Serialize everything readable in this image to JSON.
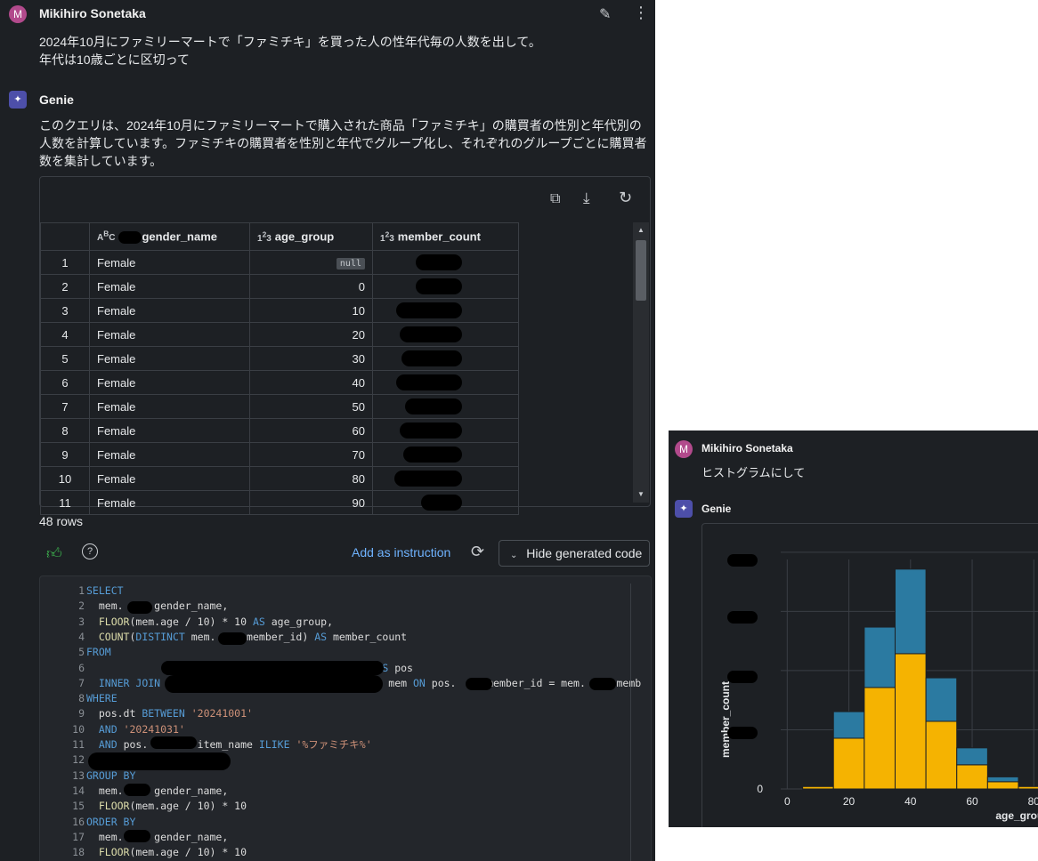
{
  "conversation": {
    "user_name": "Mikihiro Sonetaka",
    "user_initial": "M",
    "user_message_1": "2024年10月にファミリーマートで「ファミチキ」を買った人の性年代毎の人数を出して。",
    "user_message_2": "年代は10歳ごとに区切って",
    "genie_name": "Genie",
    "genie_reply_1": "このクエリは、2024年10月にファミリーマートで購入された商品「ファミチキ」の購買者の性別と年代別の",
    "genie_reply_2": "人数を計算しています。ファミチキの購買者を性別と年代でグループ化し、それぞれのグループごとに購買者",
    "genie_reply_3": "数を集計しています。"
  },
  "result_table": {
    "columns": [
      "gender_name",
      "age_group",
      "member_count"
    ],
    "rows": [
      {
        "idx": "1",
        "gender": "Female",
        "age": "null"
      },
      {
        "idx": "2",
        "gender": "Female",
        "age": "0"
      },
      {
        "idx": "3",
        "gender": "Female",
        "age": "10"
      },
      {
        "idx": "4",
        "gender": "Female",
        "age": "20"
      },
      {
        "idx": "5",
        "gender": "Female",
        "age": "30"
      },
      {
        "idx": "6",
        "gender": "Female",
        "age": "40"
      },
      {
        "idx": "7",
        "gender": "Female",
        "age": "50"
      },
      {
        "idx": "8",
        "gender": "Female",
        "age": "60"
      },
      {
        "idx": "9",
        "gender": "Female",
        "age": "70"
      },
      {
        "idx": "10",
        "gender": "Female",
        "age": "80"
      },
      {
        "idx": "11",
        "gender": "Female",
        "age": "90"
      }
    ],
    "rows_count": "48 rows"
  },
  "toolbar": {
    "add_instruction": "Add as instruction",
    "hide_code": "Hide generated code"
  },
  "code": [
    {
      "n": "1",
      "t": "SELECT"
    },
    {
      "n": "2",
      "t": "  mem.     gender_name,"
    },
    {
      "n": "3",
      "t": "  FLOOR(mem.age / 10) * 10 AS age_group,"
    },
    {
      "n": "4",
      "t": "  COUNT(DISTINCT mem.     member_id) AS member_count"
    },
    {
      "n": "5",
      "t": "FROM"
    },
    {
      "n": "6",
      "t": "                                               AS pos"
    },
    {
      "n": "7",
      "t": "  INNER JOIN                                  AS mem ON pos.     member_id = mem.     memb"
    },
    {
      "n": "8",
      "t": "WHERE"
    },
    {
      "n": "9",
      "t": "  pos.dt BETWEEN '20241001'"
    },
    {
      "n": "10",
      "t": "  AND '20241031'"
    },
    {
      "n": "11",
      "t": "  AND pos.        item_name ILIKE '%ファミチキ%'"
    },
    {
      "n": "12",
      "t": ""
    },
    {
      "n": "13",
      "t": "GROUP BY"
    },
    {
      "n": "14",
      "t": "  mem.     gender_name,"
    },
    {
      "n": "15",
      "t": "  FLOOR(mem.age / 10) * 10"
    },
    {
      "n": "16",
      "t": "ORDER BY"
    },
    {
      "n": "17",
      "t": "  mem.     gender_name,"
    },
    {
      "n": "18",
      "t": "  FLOOR(mem.age / 10) * 10"
    }
  ],
  "second_conversation": {
    "user_name": "Mikihiro Sonetaka",
    "user_initial": "M",
    "user_message": "ヒストグラムにして",
    "genie_name": "Genie"
  },
  "chart_data": {
    "type": "bar",
    "stacked": true,
    "xlabel": "age_group",
    "ylabel": "member_count",
    "x_ticks": [
      "0",
      "20",
      "40",
      "60",
      "80"
    ],
    "y_ticks": [
      "0"
    ],
    "xlim": [
      -5,
      88
    ],
    "bins": [
      5,
      15,
      25,
      35,
      45,
      55,
      65,
      75,
      85
    ],
    "series": [
      {
        "color": "#f5b301",
        "values": [
          0.01,
          0.21,
          0.42,
          0.56,
          0.28,
          0.1,
          0.03,
          0.01
        ]
      },
      {
        "color": "#2b7aa1",
        "values": [
          0.0,
          0.11,
          0.25,
          0.35,
          0.18,
          0.07,
          0.02,
          0.0
        ]
      }
    ]
  },
  "colors": {
    "background": "#1d2024",
    "link": "#6fb3ff",
    "avatar": "#b24a8c",
    "genie": "#4d4fa9"
  }
}
